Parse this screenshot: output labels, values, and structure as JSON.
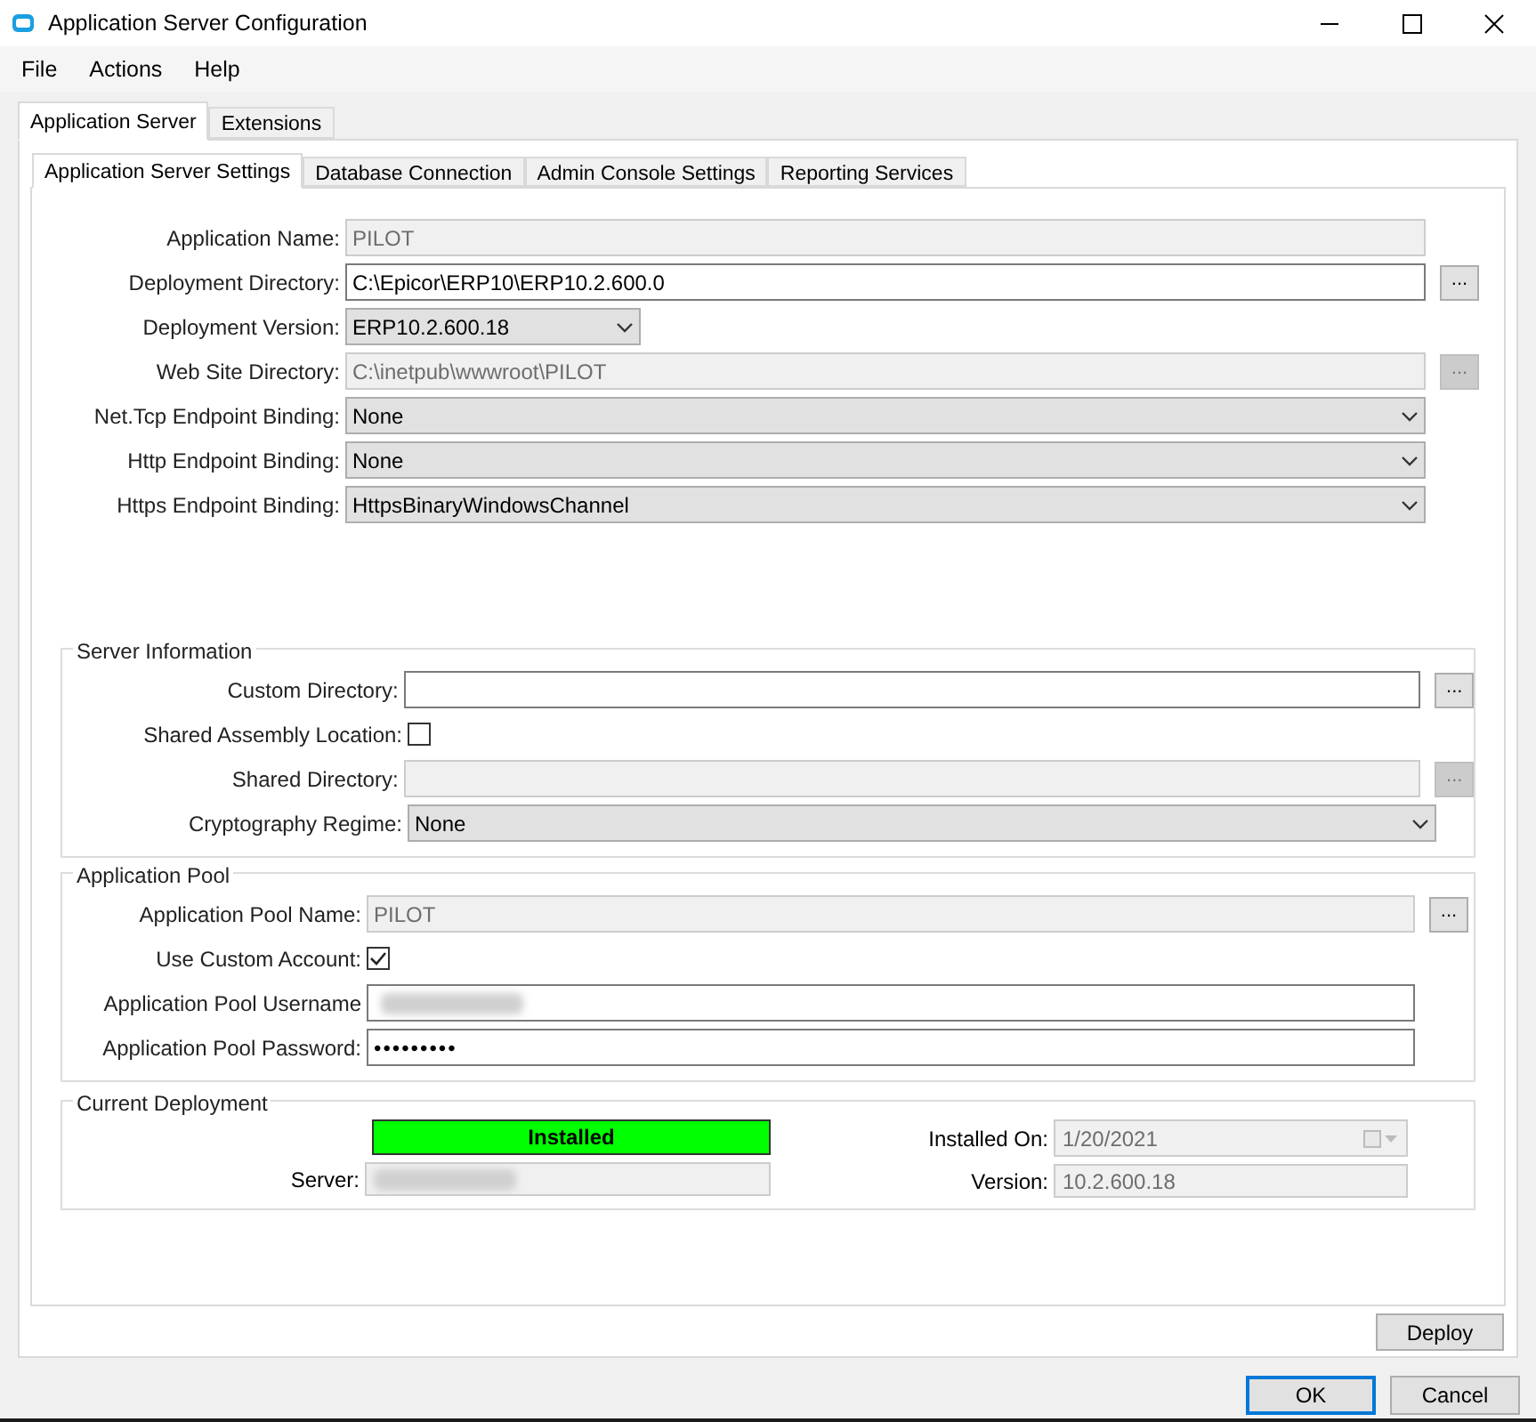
{
  "window": {
    "title": "Application Server Configuration"
  },
  "menu": [
    "File",
    "Actions",
    "Help"
  ],
  "outer_tabs": [
    {
      "label": "Application Server",
      "selected": true
    },
    {
      "label": "Extensions",
      "selected": false
    }
  ],
  "inner_tabs": [
    {
      "label": "Application Server Settings",
      "selected": true
    },
    {
      "label": "Database Connection",
      "selected": false
    },
    {
      "label": "Admin Console Settings",
      "selected": false
    },
    {
      "label": "Reporting Services",
      "selected": false
    }
  ],
  "settings": [
    {
      "kind": "text",
      "label": "Application Name:",
      "value": "PILOT",
      "disabled": true
    },
    {
      "kind": "text",
      "label": "Deployment Directory:",
      "value": "C:\\Epicor\\ERP10\\ERP10.2.600.0",
      "disabled": false,
      "browse": "...",
      "browse_disabled": false
    },
    {
      "kind": "short_combo",
      "label": "Deployment Version:",
      "value": "ERP10.2.600.18",
      "disabled": false
    },
    {
      "kind": "text",
      "label": "Web Site Directory:",
      "value": "C:\\inetpub\\wwwroot\\PILOT",
      "disabled": true,
      "browse": "...",
      "browse_disabled": true
    },
    {
      "kind": "combo",
      "label": "Net.Tcp Endpoint Binding:",
      "value": "None",
      "disabled": false
    },
    {
      "kind": "combo",
      "label": "Http Endpoint Binding:",
      "value": "None",
      "disabled": false
    },
    {
      "kind": "combo",
      "label": "Https Endpoint Binding:",
      "value": "HttpsBinaryWindowsChannel",
      "disabled": false
    }
  ],
  "server_information": {
    "title": "Server Information",
    "fields": [
      {
        "kind": "text",
        "label": "Custom Directory:",
        "disabled": false,
        "browse": "...",
        "browse_disabled": false
      },
      {
        "kind": "checkbox",
        "label": "Shared Assembly Location:",
        "checked": false
      },
      {
        "kind": "text",
        "label": "Shared Directory:",
        "disabled": true,
        "browse": "...",
        "browse_disabled": true
      },
      {
        "kind": "combo",
        "label": "Cryptography Regime:",
        "value": "None",
        "disabled": false
      }
    ]
  },
  "application_pool": {
    "title": "Application Pool",
    "fields": [
      {
        "kind": "text",
        "label": "Application Pool Name:",
        "value": "PILOT",
        "disabled": true,
        "browse": "...",
        "browse_disabled": false
      },
      {
        "kind": "checkbox",
        "label": "Use Custom Account:",
        "checked": true
      },
      {
        "kind": "text",
        "label": "Application Pool Username",
        "redacted": true,
        "disabled": false
      },
      {
        "kind": "password",
        "label": "Application Pool Password:",
        "value": "•••••••••",
        "disabled": false
      }
    ]
  },
  "current_deployment": {
    "title": "Current Deployment",
    "status": "Installed",
    "server_label": "Server:",
    "installed_on_label": "Installed On:",
    "installed_on": "1/20/2021",
    "version_label": "Version:",
    "version": "10.2.600.18"
  },
  "buttons": {
    "deploy": "Deploy",
    "ok": "OK",
    "cancel": "Cancel"
  }
}
